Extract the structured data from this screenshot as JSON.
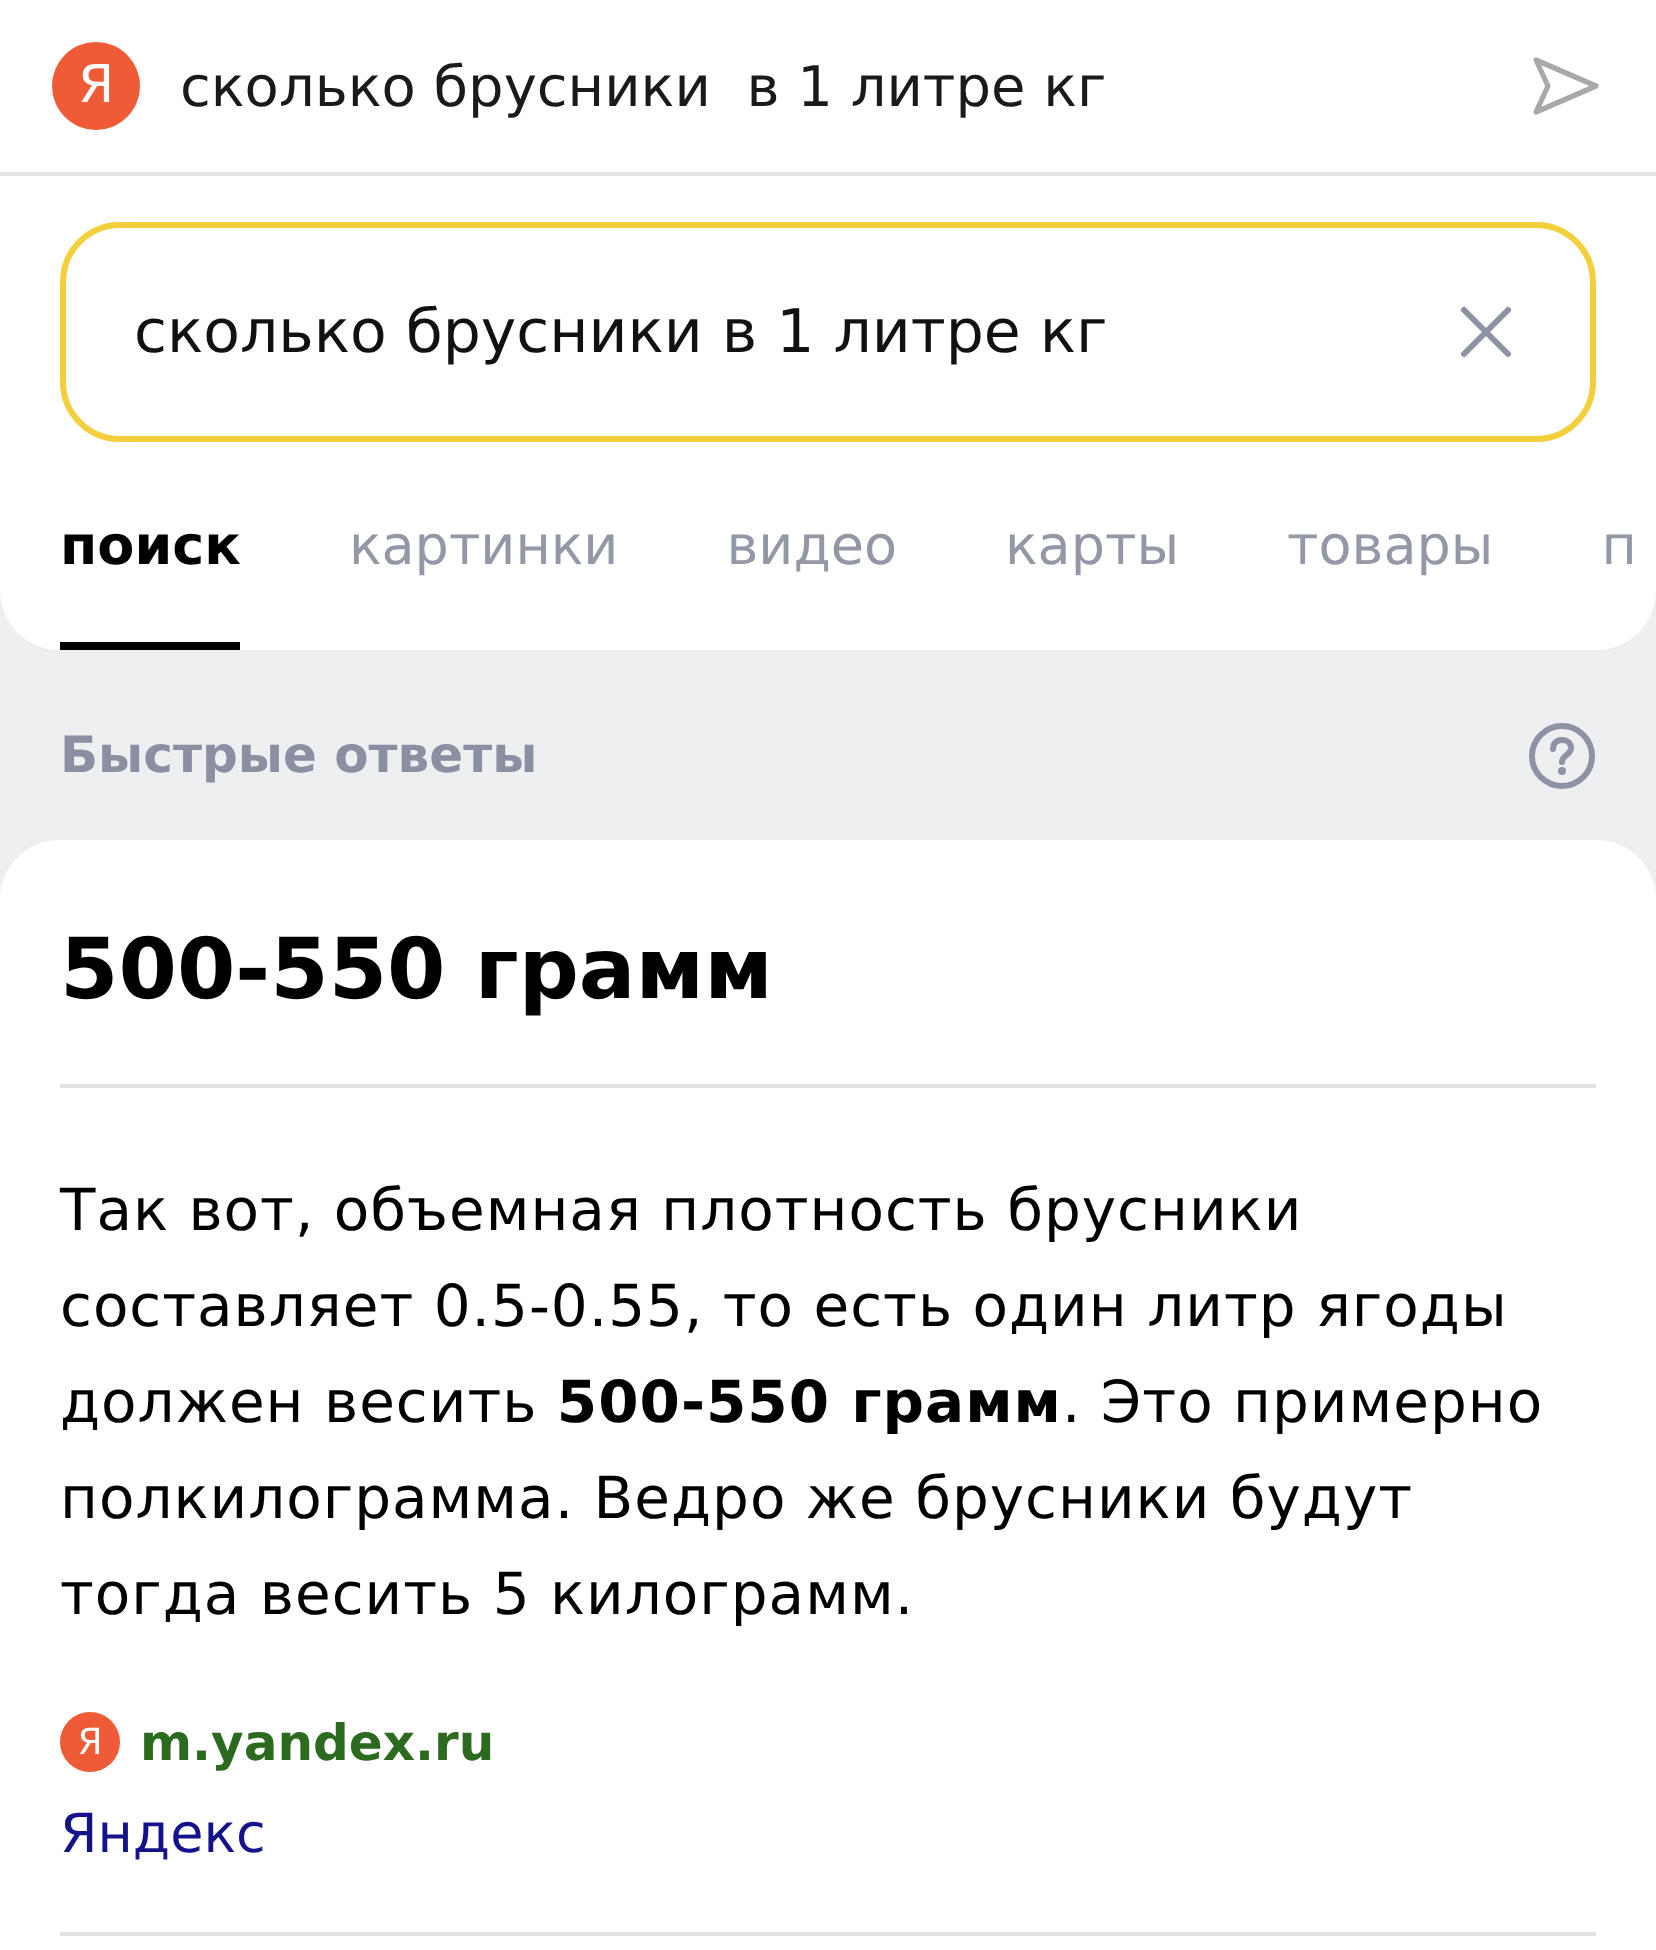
{
  "address_bar": {
    "logo": "Я",
    "query": "сколько брусники  в 1 литре кг"
  },
  "search": {
    "value": "сколько брусники в 1 литре кг"
  },
  "tabs": [
    {
      "label": "поиск",
      "selected": true
    },
    {
      "label": "картинки",
      "selected": false
    },
    {
      "label": "видео",
      "selected": false
    },
    {
      "label": "карты",
      "selected": false
    },
    {
      "label": "товары",
      "selected": false
    },
    {
      "label": "п",
      "selected": false
    }
  ],
  "quick_answers": {
    "title": "Быстрые ответы"
  },
  "answer": {
    "heading": "500-550 грамм",
    "text": "Так вот, объемная плотность брусники составляет 0.5-0.55, то есть один литр ягоды должен весить **500-550 грамм**. Это примерно полкилограмма. Ведро же брусники будут тогда весить 5 килограмм.",
    "source": {
      "logo": "Я",
      "domain": "m.yandex.ru",
      "name": "Яндекс"
    }
  }
}
